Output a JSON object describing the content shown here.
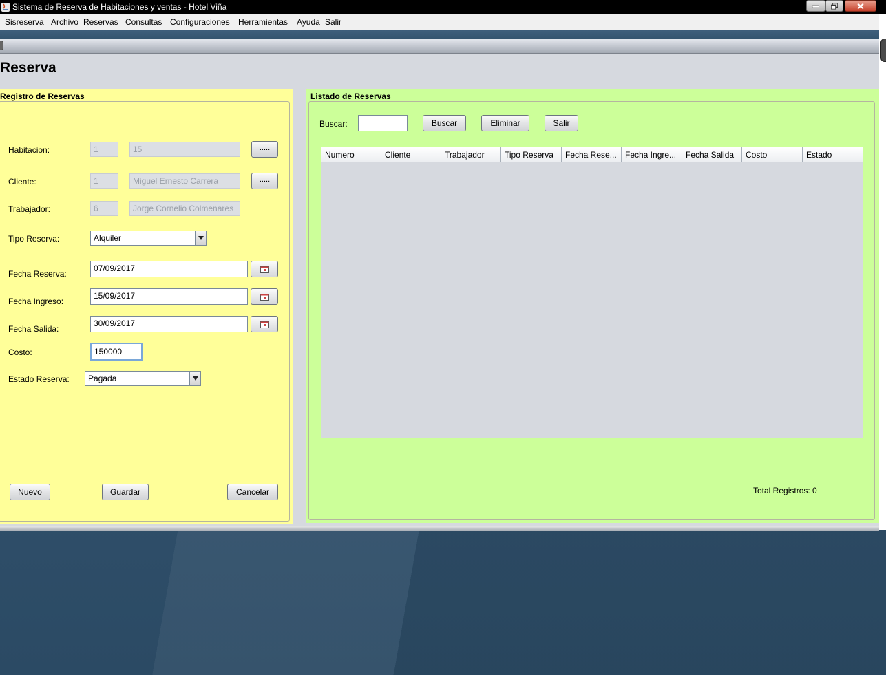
{
  "window": {
    "title": "Sistema de Reserva de Habitaciones y ventas - Hotel Viña"
  },
  "menu": [
    "Sisreserva",
    "Archivo",
    "Reservas",
    "Consultas",
    "Configuraciones",
    "Herramientas",
    "Ayuda",
    "Salir"
  ],
  "page": {
    "title": "Reserva"
  },
  "registro": {
    "caption": "Registro de Reservas",
    "habitacion": {
      "label": "Habitacion:",
      "id": "1",
      "value": "15",
      "button": "....."
    },
    "cliente": {
      "label": "Cliente:",
      "id": "1",
      "value": "Miguel Ernesto Carrera",
      "button": "....."
    },
    "trabajador": {
      "label": "Trabajador:",
      "id": "6",
      "value": "Jorge Cornelio Colmenares"
    },
    "tipo_reserva": {
      "label": "Tipo Reserva:",
      "selected": "Alquiler"
    },
    "fecha_reserva": {
      "label": "Fecha Reserva:",
      "value": "07/09/2017"
    },
    "fecha_ingreso": {
      "label": "Fecha Ingreso:",
      "value": "15/09/2017"
    },
    "fecha_salida": {
      "label": "Fecha Salida:",
      "value": "30/09/2017"
    },
    "costo": {
      "label": "Costo:",
      "value": "150000"
    },
    "estado_reserva": {
      "label": "Estado Reserva:",
      "selected": "Pagada"
    },
    "buttons": {
      "nuevo": "Nuevo",
      "guardar": "Guardar",
      "cancelar": "Cancelar"
    }
  },
  "listado": {
    "caption": "Listado de Reservas",
    "search_label": "Buscar:",
    "search_value": "",
    "buttons": {
      "buscar": "Buscar",
      "eliminar": "Eliminar",
      "salir": "Salir"
    },
    "columns": [
      "Numero",
      "Cliente",
      "Trabajador",
      "Tipo Reserva",
      "Fecha Rese...",
      "Fecha Ingre...",
      "Fecha Salida",
      "Costo",
      "Estado"
    ],
    "rows": [],
    "total": "Total Registros: 0"
  },
  "colors": {
    "left_panel": "#ffff99",
    "right_panel": "#ccff99",
    "frame_bg": "#d6d9df"
  },
  "icons": [
    "java-app-icon",
    "minimize-icon",
    "maximize-icon",
    "close-icon",
    "calendar-icon",
    "combo-arrow-icon"
  ]
}
